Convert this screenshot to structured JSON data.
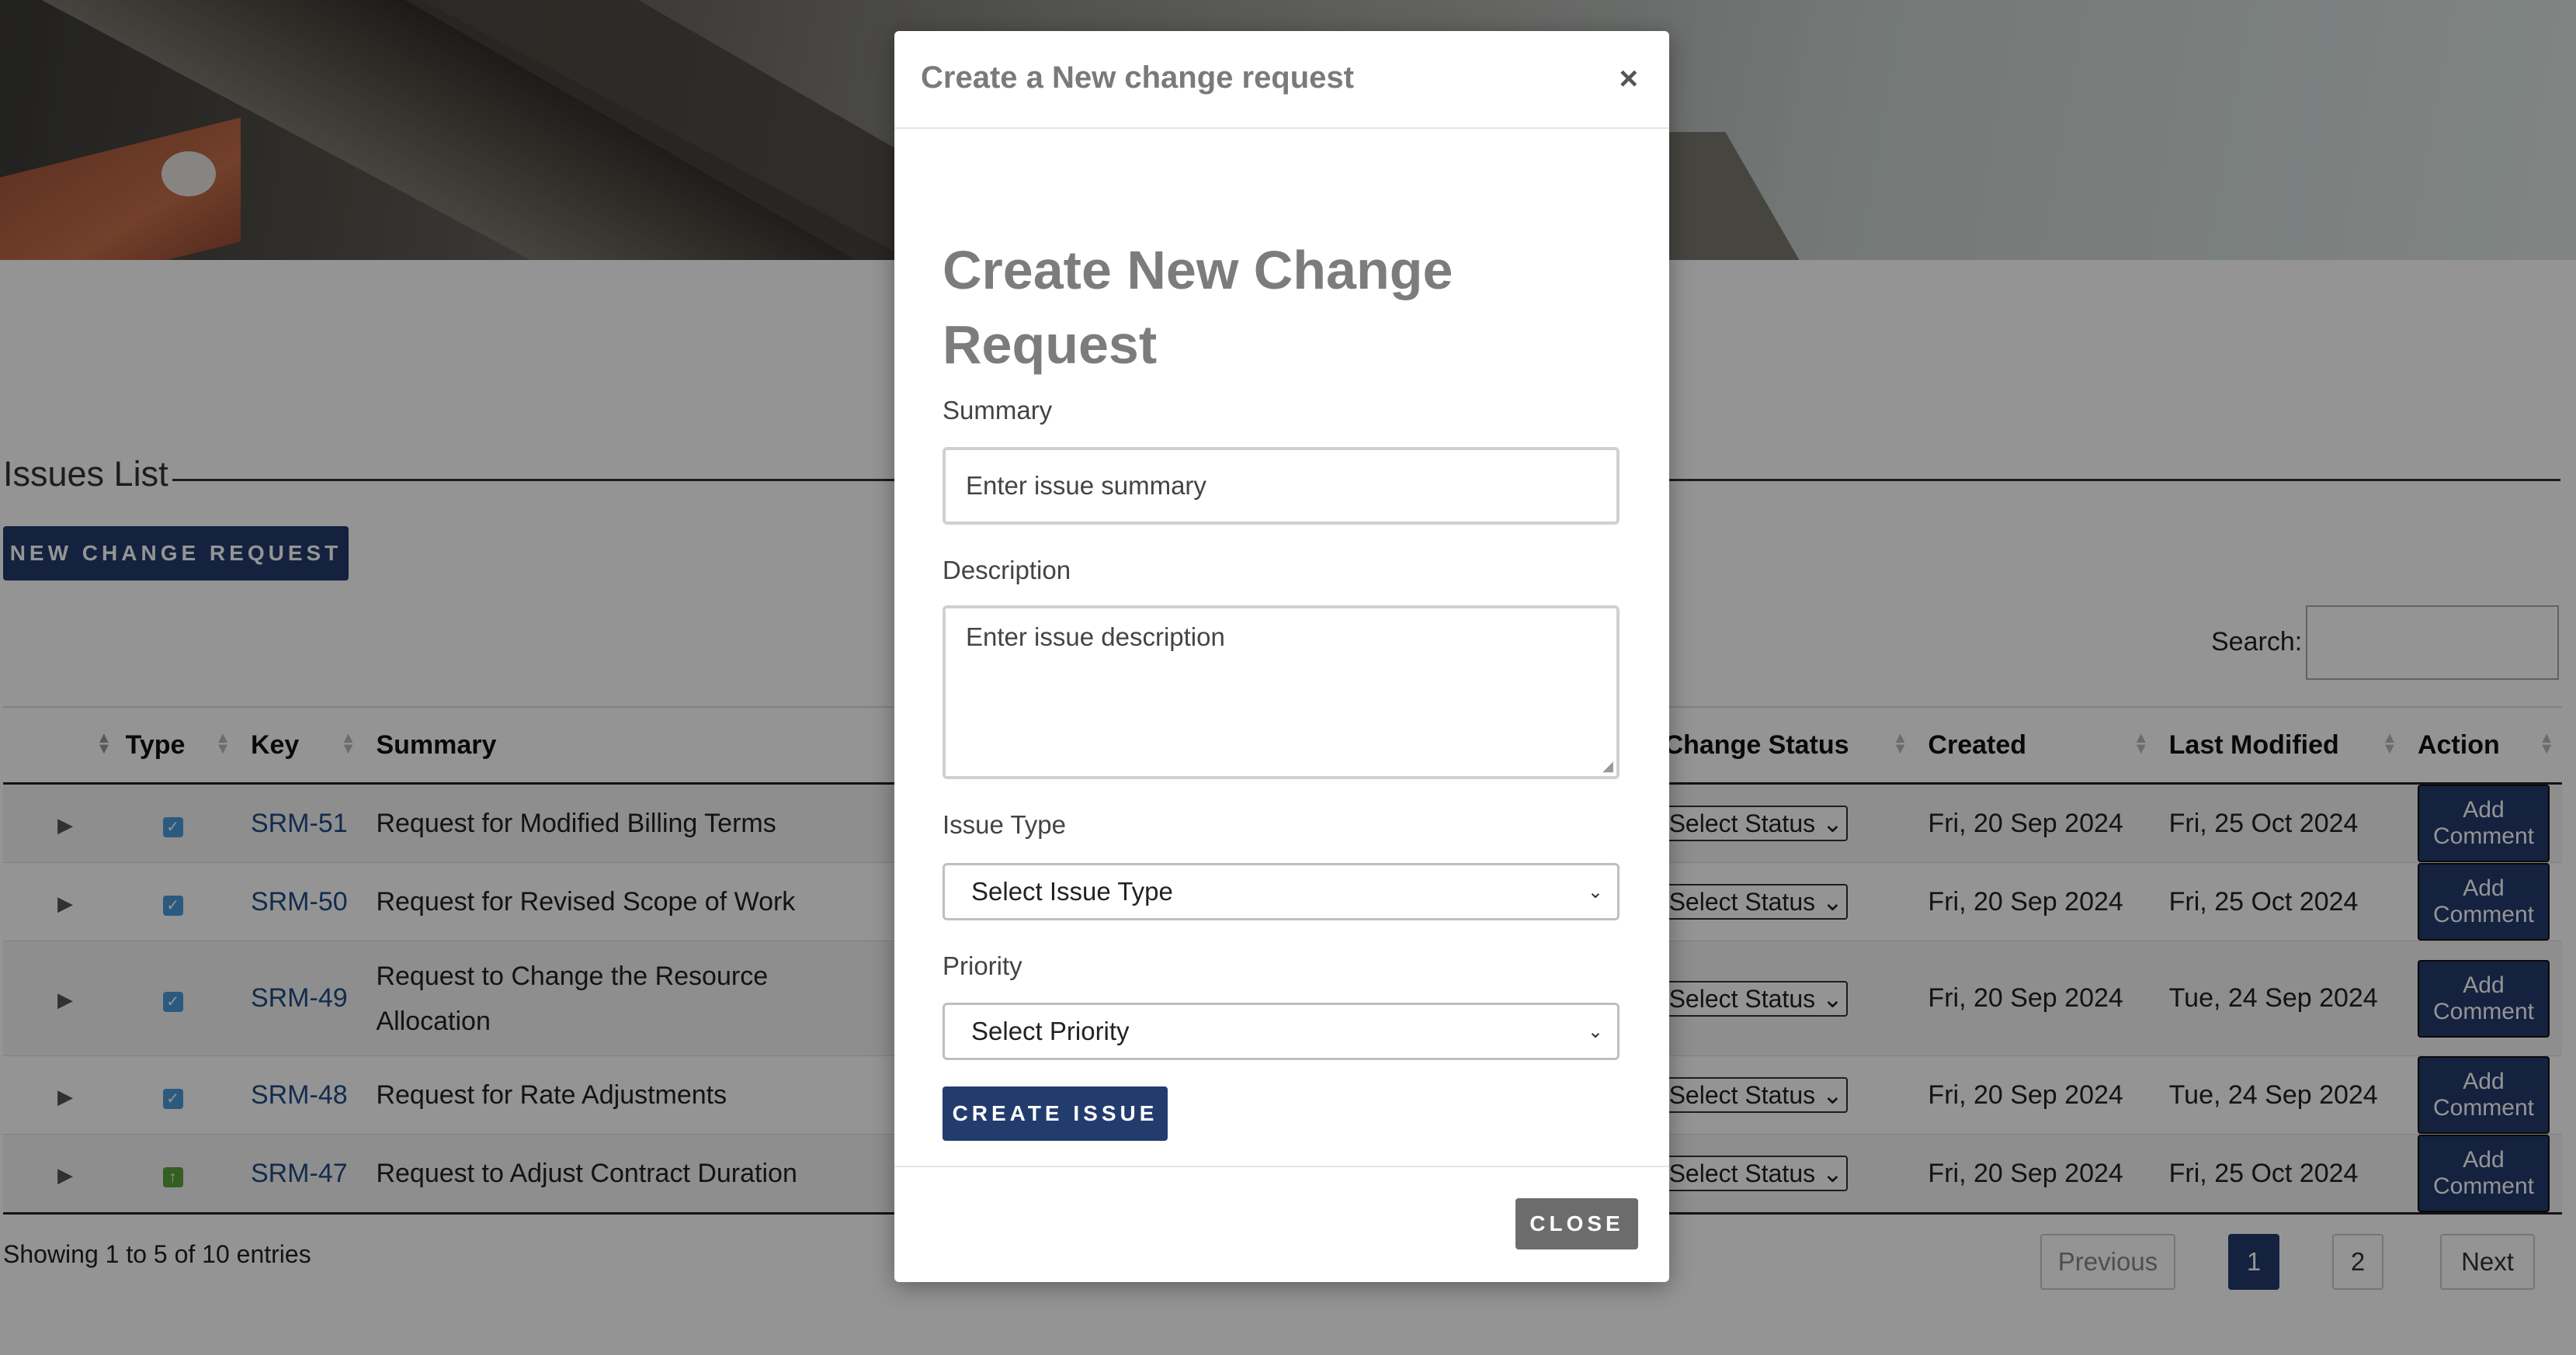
{
  "issues": {
    "title": "Issues List",
    "new_button": "NEW CHANGE REQUEST",
    "search_label": "Search:",
    "columns": [
      "",
      "Type",
      "Key",
      "Summary",
      "Change Status",
      "Created",
      "Last Modified",
      "Action"
    ],
    "rows": [
      {
        "key": "SRM-51",
        "summary": "Request for Modified Billing Terms",
        "status": "Select Status",
        "created": "Fri, 20 Sep 2024",
        "modified": "Fri, 25 Oct 2024",
        "action": "Add Comment",
        "type_icon": "task-checkbox-icon"
      },
      {
        "key": "SRM-50",
        "summary": "Request for Revised Scope of Work",
        "status": "Select Status",
        "created": "Fri, 20 Sep 2024",
        "modified": "Fri, 25 Oct 2024",
        "action": "Add Comment",
        "type_icon": "task-checkbox-icon"
      },
      {
        "key": "SRM-49",
        "summary": "Request to Change the Resource Allocation",
        "status": "Select Status",
        "created": "Fri, 20 Sep 2024",
        "modified": "Tue, 24 Sep 2024",
        "action": "Add Comment",
        "type_icon": "task-checkbox-icon"
      },
      {
        "key": "SRM-48",
        "summary": "Request for Rate Adjustments",
        "status": "Select Status",
        "created": "Fri, 20 Sep 2024",
        "modified": "Tue, 24 Sep 2024",
        "action": "Add Comment",
        "type_icon": "task-checkbox-icon"
      },
      {
        "key": "SRM-47",
        "summary": "Request to Adjust Contract Duration",
        "status": "Select Status",
        "created": "Fri, 20 Sep 2024",
        "modified": "Fri, 25 Oct 2024",
        "action": "Add Comment",
        "type_icon": "improvement-arrow-icon"
      }
    ],
    "entries_info": "Showing 1 to 5 of 10 entries",
    "pagination": {
      "previous": "Previous",
      "pages": [
        "1",
        "2"
      ],
      "next": "Next",
      "current": "1"
    }
  },
  "modal": {
    "title": "Create a New change request",
    "close_x": "×",
    "heading": "Create New Change Request",
    "summary_label": "Summary",
    "summary_placeholder": "Enter issue summary",
    "description_label": "Description",
    "description_placeholder": "Enter issue description",
    "issue_type_label": "Issue Type",
    "issue_type_selected": "Select Issue Type",
    "priority_label": "Priority",
    "priority_selected": "Select Priority",
    "create_button": "CREATE ISSUE",
    "close_button": "CLOSE"
  },
  "colors": {
    "primary": "#233c6e",
    "link": "#1f4d86",
    "close_button": "#6c6c6c"
  }
}
